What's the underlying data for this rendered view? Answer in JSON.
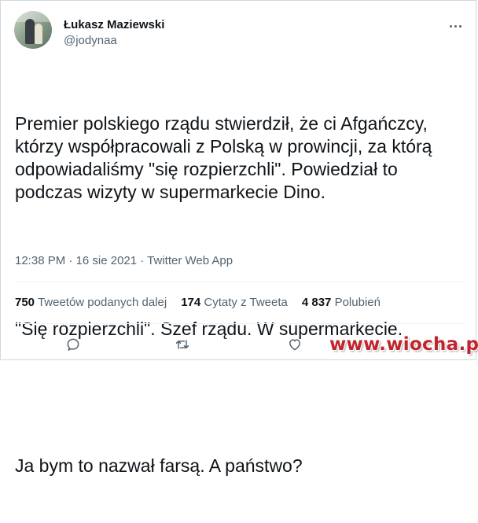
{
  "author": {
    "display_name": "Łukasz Maziewski",
    "handle": "@jodynaa"
  },
  "tweet": {
    "paragraphs": [
      "Premier polskiego rządu stwierdził, że ci Afgańczcy, którzy współpracowali z Polską w prowincji, za którą odpowiadaliśmy \"się rozpierzchli\". Powiedział to podczas wizyty w supermarkecie Dino.",
      "\"Się rozpierzchli\". Szef rządu. W supermarkecie.",
      "Ja bym to nazwał farsą. A państwo?"
    ],
    "timestamp": "12:38 PM · 16 sie 2021 · Twitter Web App"
  },
  "stats": {
    "retweets": {
      "count": "750",
      "label": "Tweetów podanych dalej"
    },
    "quotes": {
      "count": "174",
      "label": "Cytaty z Tweeta"
    },
    "likes": {
      "count": "4 837",
      "label": "Polubień"
    }
  },
  "icons": {
    "more": "more-horizontal-icon",
    "reply": "reply-bubble-icon",
    "retweet": "retweet-icon",
    "like": "heart-icon"
  },
  "colors": {
    "text_primary": "#0f1419",
    "text_secondary": "#536471",
    "watermark": "#c0242f"
  },
  "watermark": "www.wiocha.pl"
}
